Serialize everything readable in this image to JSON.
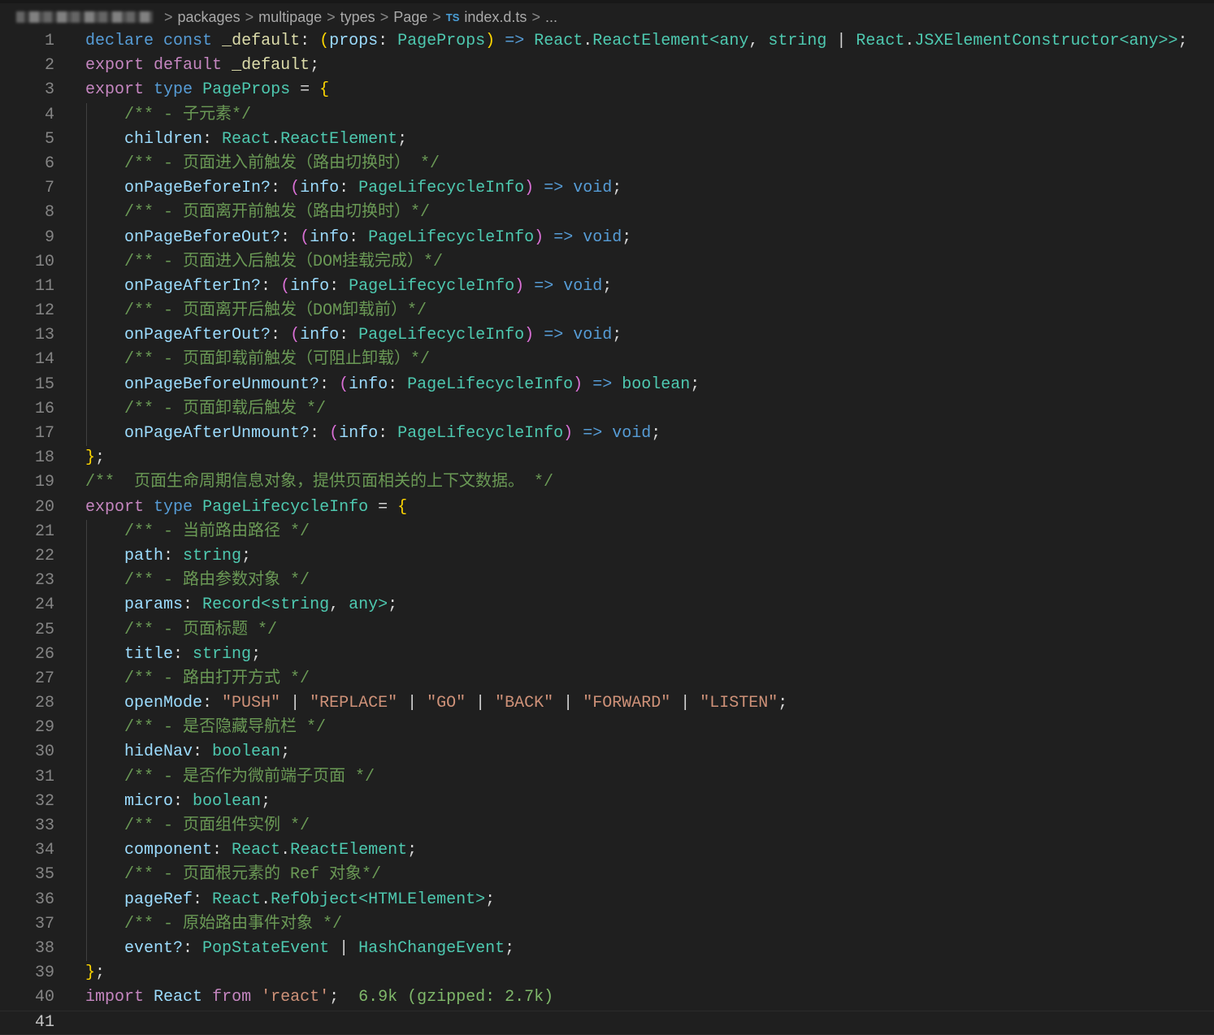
{
  "breadcrumb": {
    "items": [
      "packages",
      "multipage",
      "types",
      "Page"
    ],
    "file_badge": "TS",
    "file": "index.d.ts",
    "more": "...",
    "separator": ">"
  },
  "active_line": 41,
  "lines": [
    [
      [
        "k",
        "declare"
      ],
      [
        "o",
        " "
      ],
      [
        "k",
        "const"
      ],
      [
        "o",
        " "
      ],
      [
        "f",
        "_default"
      ],
      [
        "o",
        ": "
      ],
      [
        "b1",
        "("
      ],
      [
        "p",
        "props"
      ],
      [
        "o",
        ": "
      ],
      [
        "t",
        "PageProps"
      ],
      [
        "b1",
        ")"
      ],
      [
        "o",
        " "
      ],
      [
        "k",
        "=>"
      ],
      [
        "o",
        " "
      ],
      [
        "t",
        "React"
      ],
      [
        "o",
        "."
      ],
      [
        "t",
        "ReactElement"
      ],
      [
        "t",
        "<"
      ],
      [
        "t",
        "any"
      ],
      [
        "o",
        ", "
      ],
      [
        "t",
        "string"
      ],
      [
        "o",
        " | "
      ],
      [
        "t",
        "React"
      ],
      [
        "o",
        "."
      ],
      [
        "t",
        "JSXElementConstructor"
      ],
      [
        "t",
        "<"
      ],
      [
        "t",
        "any"
      ],
      [
        "t",
        ">>"
      ],
      [
        "o",
        ";"
      ]
    ],
    [
      [
        "c",
        "export"
      ],
      [
        "o",
        " "
      ],
      [
        "c",
        "default"
      ],
      [
        "o",
        " "
      ],
      [
        "f",
        "_default"
      ],
      [
        "o",
        ";"
      ]
    ],
    [
      [
        "c",
        "export"
      ],
      [
        "o",
        " "
      ],
      [
        "k",
        "type"
      ],
      [
        "o",
        " "
      ],
      [
        "t",
        "PageProps"
      ],
      [
        "o",
        " = "
      ],
      [
        "b1",
        "{"
      ]
    ],
    [
      [
        "m",
        "    /** - 子元素*/"
      ]
    ],
    [
      [
        "p",
        "    children"
      ],
      [
        "o",
        ": "
      ],
      [
        "t",
        "React"
      ],
      [
        "o",
        "."
      ],
      [
        "t",
        "ReactElement"
      ],
      [
        "o",
        ";"
      ]
    ],
    [
      [
        "m",
        "    /** - 页面进入前触发（路由切换时） */"
      ]
    ],
    [
      [
        "p",
        "    onPageBeforeIn?"
      ],
      [
        "o",
        ": "
      ],
      [
        "b2",
        "("
      ],
      [
        "p",
        "info"
      ],
      [
        "o",
        ": "
      ],
      [
        "t",
        "PageLifecycleInfo"
      ],
      [
        "b2",
        ")"
      ],
      [
        "o",
        " "
      ],
      [
        "k",
        "=>"
      ],
      [
        "o",
        " "
      ],
      [
        "k",
        "void"
      ],
      [
        "o",
        ";"
      ]
    ],
    [
      [
        "m",
        "    /** - 页面离开前触发（路由切换时）*/"
      ]
    ],
    [
      [
        "p",
        "    onPageBeforeOut?"
      ],
      [
        "o",
        ": "
      ],
      [
        "b2",
        "("
      ],
      [
        "p",
        "info"
      ],
      [
        "o",
        ": "
      ],
      [
        "t",
        "PageLifecycleInfo"
      ],
      [
        "b2",
        ")"
      ],
      [
        "o",
        " "
      ],
      [
        "k",
        "=>"
      ],
      [
        "o",
        " "
      ],
      [
        "k",
        "void"
      ],
      [
        "o",
        ";"
      ]
    ],
    [
      [
        "m",
        "    /** - 页面进入后触发（DOM挂载完成）*/"
      ]
    ],
    [
      [
        "p",
        "    onPageAfterIn?"
      ],
      [
        "o",
        ": "
      ],
      [
        "b2",
        "("
      ],
      [
        "p",
        "info"
      ],
      [
        "o",
        ": "
      ],
      [
        "t",
        "PageLifecycleInfo"
      ],
      [
        "b2",
        ")"
      ],
      [
        "o",
        " "
      ],
      [
        "k",
        "=>"
      ],
      [
        "o",
        " "
      ],
      [
        "k",
        "void"
      ],
      [
        "o",
        ";"
      ]
    ],
    [
      [
        "m",
        "    /** - 页面离开后触发（DOM卸载前）*/"
      ]
    ],
    [
      [
        "p",
        "    onPageAfterOut?"
      ],
      [
        "o",
        ": "
      ],
      [
        "b2",
        "("
      ],
      [
        "p",
        "info"
      ],
      [
        "o",
        ": "
      ],
      [
        "t",
        "PageLifecycleInfo"
      ],
      [
        "b2",
        ")"
      ],
      [
        "o",
        " "
      ],
      [
        "k",
        "=>"
      ],
      [
        "o",
        " "
      ],
      [
        "k",
        "void"
      ],
      [
        "o",
        ";"
      ]
    ],
    [
      [
        "m",
        "    /** - 页面卸载前触发（可阻止卸载）*/"
      ]
    ],
    [
      [
        "p",
        "    onPageBeforeUnmount?"
      ],
      [
        "o",
        ": "
      ],
      [
        "b2",
        "("
      ],
      [
        "p",
        "info"
      ],
      [
        "o",
        ": "
      ],
      [
        "t",
        "PageLifecycleInfo"
      ],
      [
        "b2",
        ")"
      ],
      [
        "o",
        " "
      ],
      [
        "k",
        "=>"
      ],
      [
        "o",
        " "
      ],
      [
        "t",
        "boolean"
      ],
      [
        "o",
        ";"
      ]
    ],
    [
      [
        "m",
        "    /** - 页面卸载后触发 */"
      ]
    ],
    [
      [
        "p",
        "    onPageAfterUnmount?"
      ],
      [
        "o",
        ": "
      ],
      [
        "b2",
        "("
      ],
      [
        "p",
        "info"
      ],
      [
        "o",
        ": "
      ],
      [
        "t",
        "PageLifecycleInfo"
      ],
      [
        "b2",
        ")"
      ],
      [
        "o",
        " "
      ],
      [
        "k",
        "=>"
      ],
      [
        "o",
        " "
      ],
      [
        "k",
        "void"
      ],
      [
        "o",
        ";"
      ]
    ],
    [
      [
        "b1",
        "}"
      ],
      [
        "o",
        ";"
      ]
    ],
    [
      [
        "m",
        "/**  页面生命周期信息对象，提供页面相关的上下文数据。 */"
      ]
    ],
    [
      [
        "c",
        "export"
      ],
      [
        "o",
        " "
      ],
      [
        "k",
        "type"
      ],
      [
        "o",
        " "
      ],
      [
        "t",
        "PageLifecycleInfo"
      ],
      [
        "o",
        " = "
      ],
      [
        "b1",
        "{"
      ]
    ],
    [
      [
        "m",
        "    /** - 当前路由路径 */"
      ]
    ],
    [
      [
        "p",
        "    path"
      ],
      [
        "o",
        ": "
      ],
      [
        "t",
        "string"
      ],
      [
        "o",
        ";"
      ]
    ],
    [
      [
        "m",
        "    /** - 路由参数对象 */"
      ]
    ],
    [
      [
        "p",
        "    params"
      ],
      [
        "o",
        ": "
      ],
      [
        "t",
        "Record"
      ],
      [
        "t",
        "<"
      ],
      [
        "t",
        "string"
      ],
      [
        "o",
        ", "
      ],
      [
        "t",
        "any"
      ],
      [
        "t",
        ">"
      ],
      [
        "o",
        ";"
      ]
    ],
    [
      [
        "m",
        "    /** - 页面标题 */"
      ]
    ],
    [
      [
        "p",
        "    title"
      ],
      [
        "o",
        ": "
      ],
      [
        "t",
        "string"
      ],
      [
        "o",
        ";"
      ]
    ],
    [
      [
        "m",
        "    /** - 路由打开方式 */"
      ]
    ],
    [
      [
        "p",
        "    openMode"
      ],
      [
        "o",
        ": "
      ],
      [
        "s",
        "\"PUSH\""
      ],
      [
        "o",
        " | "
      ],
      [
        "s",
        "\"REPLACE\""
      ],
      [
        "o",
        " | "
      ],
      [
        "s",
        "\"GO\""
      ],
      [
        "o",
        " | "
      ],
      [
        "s",
        "\"BACK\""
      ],
      [
        "o",
        " | "
      ],
      [
        "s",
        "\"FORWARD\""
      ],
      [
        "o",
        " | "
      ],
      [
        "s",
        "\"LISTEN\""
      ],
      [
        "o",
        ";"
      ]
    ],
    [
      [
        "m",
        "    /** - 是否隐藏导航栏 */"
      ]
    ],
    [
      [
        "p",
        "    hideNav"
      ],
      [
        "o",
        ": "
      ],
      [
        "t",
        "boolean"
      ],
      [
        "o",
        ";"
      ]
    ],
    [
      [
        "m",
        "    /** - 是否作为微前端子页面 */"
      ]
    ],
    [
      [
        "p",
        "    micro"
      ],
      [
        "o",
        ": "
      ],
      [
        "t",
        "boolean"
      ],
      [
        "o",
        ";"
      ]
    ],
    [
      [
        "m",
        "    /** - 页面组件实例 */"
      ]
    ],
    [
      [
        "p",
        "    component"
      ],
      [
        "o",
        ": "
      ],
      [
        "t",
        "React"
      ],
      [
        "o",
        "."
      ],
      [
        "t",
        "ReactElement"
      ],
      [
        "o",
        ";"
      ]
    ],
    [
      [
        "m",
        "    /** - 页面根元素的 Ref 对象*/"
      ]
    ],
    [
      [
        "p",
        "    pageRef"
      ],
      [
        "o",
        ": "
      ],
      [
        "t",
        "React"
      ],
      [
        "o",
        "."
      ],
      [
        "t",
        "RefObject"
      ],
      [
        "t",
        "<"
      ],
      [
        "t",
        "HTMLElement"
      ],
      [
        "t",
        ">"
      ],
      [
        "o",
        ";"
      ]
    ],
    [
      [
        "m",
        "    /** - 原始路由事件对象 */"
      ]
    ],
    [
      [
        "p",
        "    event?"
      ],
      [
        "o",
        ": "
      ],
      [
        "t",
        "PopStateEvent"
      ],
      [
        "o",
        " | "
      ],
      [
        "t",
        "HashChangeEvent"
      ],
      [
        "o",
        ";"
      ]
    ],
    [
      [
        "b1",
        "}"
      ],
      [
        "o",
        ";"
      ]
    ],
    [
      [
        "c",
        "import"
      ],
      [
        "o",
        " "
      ],
      [
        "p",
        "React"
      ],
      [
        "o",
        " "
      ],
      [
        "c",
        "from"
      ],
      [
        "o",
        " "
      ],
      [
        "s",
        "'react'"
      ],
      [
        "o",
        ";  "
      ],
      [
        "g",
        "6.9k (gzipped: 2.7k)"
      ]
    ],
    []
  ]
}
